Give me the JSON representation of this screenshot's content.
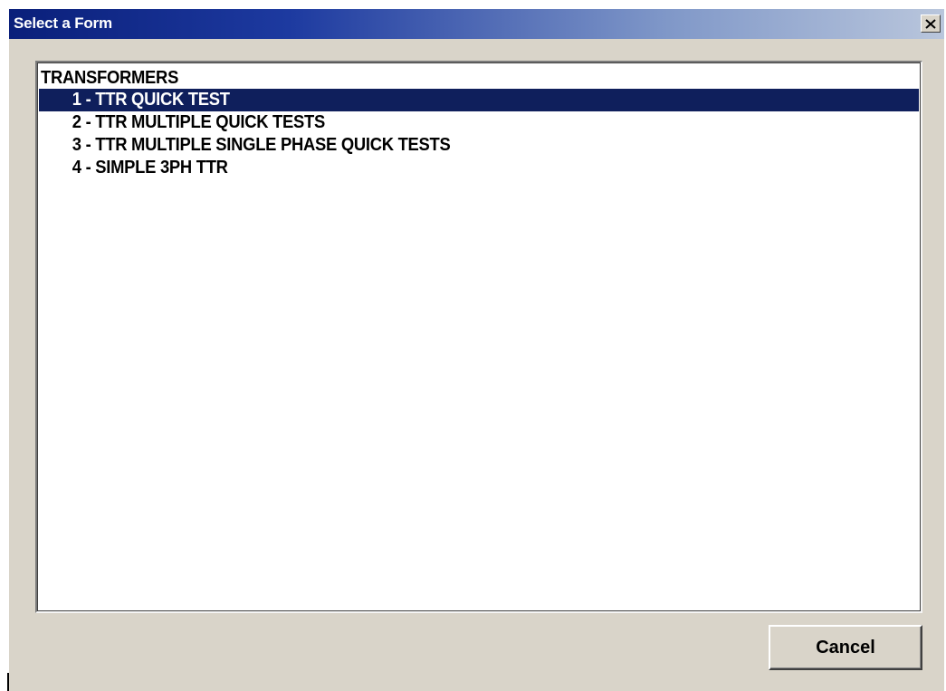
{
  "window": {
    "title": "Select a Form",
    "close_icon": "close-icon",
    "titlebar_color_start": "#0a1f7a",
    "titlebar_color_end": "#b9c6dc",
    "background_color": "#d9d4c9"
  },
  "list": {
    "group_label": "TRANSFORMERS",
    "selected_color": "#0f1f5c",
    "items": [
      {
        "label": "1 - TTR QUICK TEST",
        "selected": true
      },
      {
        "label": "2 - TTR MULTIPLE QUICK TESTS",
        "selected": false
      },
      {
        "label": "3 - TTR MULTIPLE SINGLE PHASE QUICK TESTS",
        "selected": false
      },
      {
        "label": "4 - SIMPLE 3PH TTR",
        "selected": false
      }
    ]
  },
  "buttons": {
    "cancel_label": "Cancel"
  }
}
